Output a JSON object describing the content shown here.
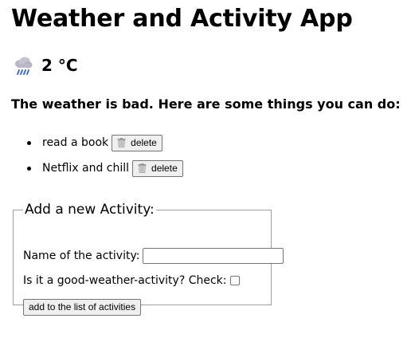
{
  "app": {
    "title": "Weather and Activity App"
  },
  "weather": {
    "icon": "rain-cloud-icon",
    "temperature": "2 °C",
    "message": "The weather is bad. Here are some things you can do:"
  },
  "activities": [
    {
      "label": "read a book",
      "delete_label": "delete",
      "delete_icon": "trash-icon"
    },
    {
      "label": "Netflix and chill",
      "delete_label": "delete",
      "delete_icon": "trash-icon"
    }
  ],
  "form": {
    "legend": "Add a new Activity:",
    "name_label": "Name of the activity:",
    "name_value": "",
    "good_weather_label": "Is it a good-weather-activity? Check:",
    "good_weather_checked": false,
    "submit_label": "add to the list of activities"
  },
  "colors": {
    "cloud": "#b9b9c6",
    "rain": "#3f6fd6",
    "button_bg": "#efefef",
    "button_border": "#767676",
    "fieldset_border": "#a0a0a0"
  }
}
